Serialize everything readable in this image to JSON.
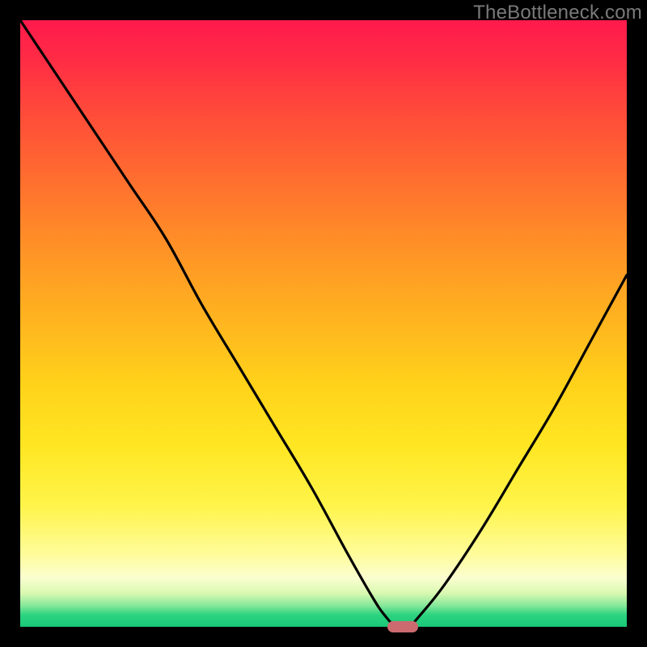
{
  "watermark": "TheBottleneck.com",
  "chart_data": {
    "type": "line",
    "title": "",
    "xlabel": "",
    "ylabel": "",
    "xlim": [
      0,
      100
    ],
    "ylim": [
      0,
      100
    ],
    "grid": false,
    "x": [
      0,
      6,
      12,
      18,
      24,
      30,
      36,
      42,
      48,
      54,
      58,
      60,
      62,
      64,
      66,
      70,
      76,
      82,
      88,
      94,
      100
    ],
    "values": [
      100,
      91,
      82,
      73,
      64,
      53,
      43,
      33,
      23,
      12,
      5,
      2,
      0,
      0,
      2,
      7,
      16,
      26,
      36,
      47,
      58
    ],
    "marker": {
      "x": 63,
      "y": 0
    },
    "colors": {
      "curve": "#000000",
      "marker": "#cc6b6f",
      "gradient_top": "#ff1a4d",
      "gradient_bottom": "#18c878"
    }
  }
}
